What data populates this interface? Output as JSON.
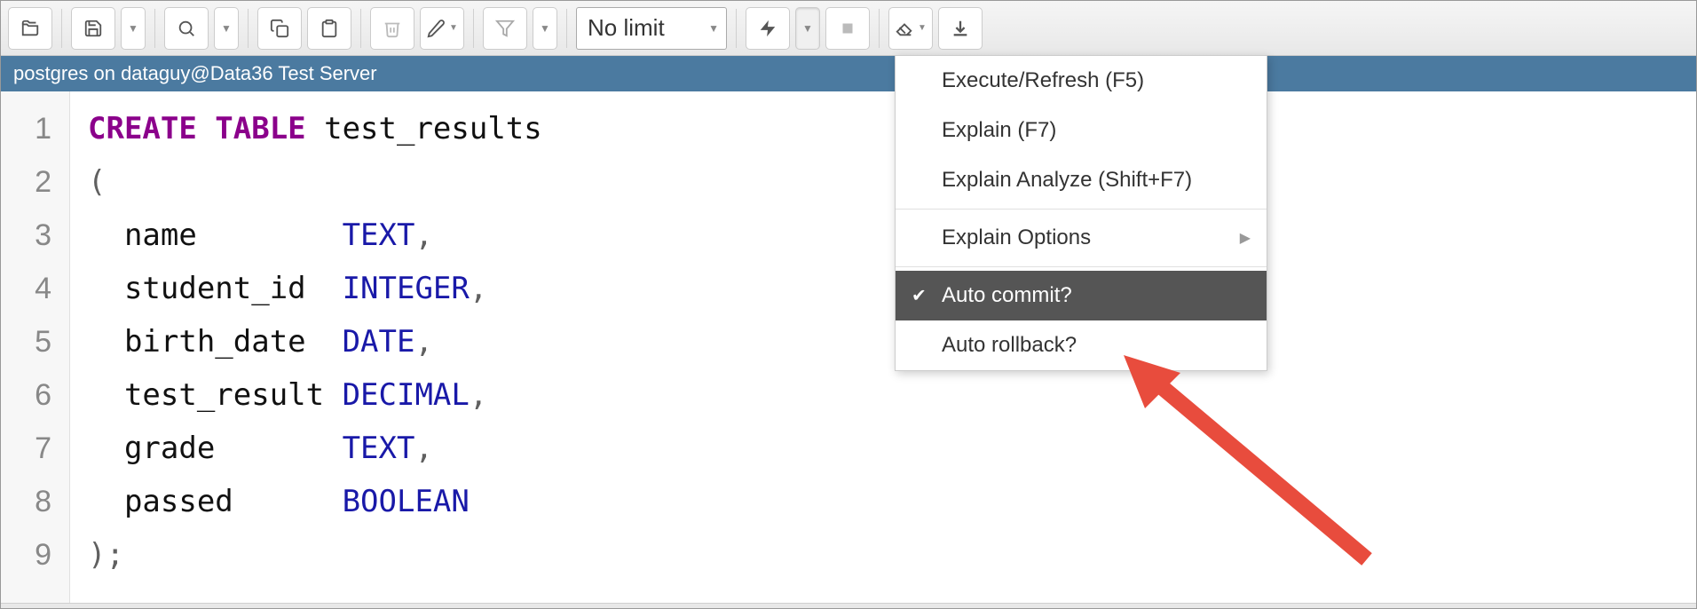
{
  "toolbar": {
    "limit_select": "No limit"
  },
  "connection": {
    "label": "postgres on dataguy@Data36 Test Server"
  },
  "editor": {
    "lines": [
      "1",
      "2",
      "3",
      "4",
      "5",
      "6",
      "7",
      "8",
      "9"
    ],
    "code": {
      "l1_kw": "CREATE TABLE",
      "l1_id": " test_results",
      "l2": "(",
      "l3_id": "  name        ",
      "l3_ty": "TEXT",
      "l4_id": "  student_id  ",
      "l4_ty": "INTEGER",
      "l5_id": "  birth_date  ",
      "l5_ty": "DATE",
      "l6_id": "  test_result ",
      "l6_ty": "DECIMAL",
      "l7_id": "  grade       ",
      "l7_ty": "TEXT",
      "l8_id": "  passed      ",
      "l8_ty": "BOOLEAN",
      "l9": ");",
      "comma": ","
    }
  },
  "dropdown": {
    "execute": "Execute/Refresh (F5)",
    "explain": "Explain (F7)",
    "explain_analyze": "Explain Analyze (Shift+F7)",
    "explain_options": "Explain Options",
    "auto_commit": "Auto commit?",
    "auto_rollback": "Auto rollback?"
  }
}
